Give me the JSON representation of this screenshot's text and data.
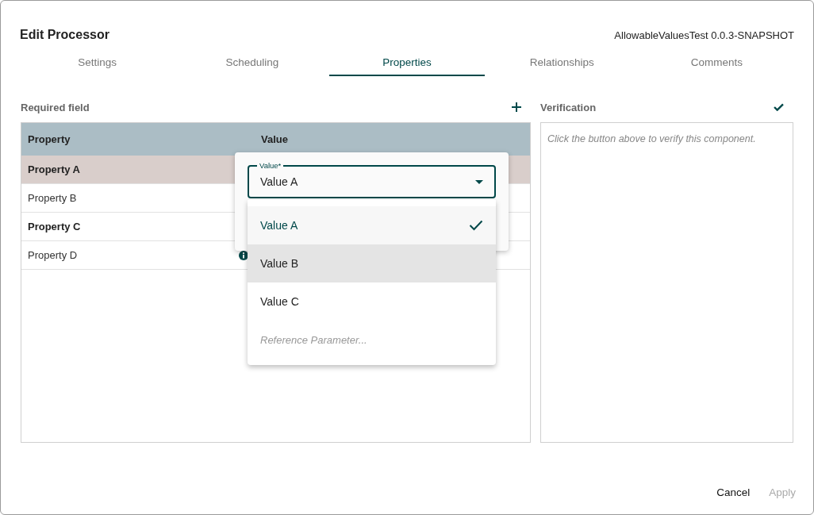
{
  "dialog": {
    "title": "Edit Processor",
    "component": "AllowableValuesTest 0.0.3-SNAPSHOT"
  },
  "tabs": [
    {
      "label": "Settings",
      "selected": false
    },
    {
      "label": "Scheduling",
      "selected": false
    },
    {
      "label": "Properties",
      "selected": true
    },
    {
      "label": "Relationships",
      "selected": false
    },
    {
      "label": "Comments",
      "selected": false
    }
  ],
  "properties": {
    "title": "Required field",
    "columns": [
      "Property",
      "Value"
    ],
    "rows": [
      {
        "name": "Property A",
        "required": true,
        "selected": true
      },
      {
        "name": "Property B",
        "required": false,
        "selected": false
      },
      {
        "name": "Property C",
        "required": true,
        "selected": false
      },
      {
        "name": "Property D",
        "required": false,
        "selected": false,
        "info": true
      }
    ]
  },
  "verification": {
    "title": "Verification",
    "message": "Click the button above to verify this component."
  },
  "editor": {
    "label": "Value*",
    "value": "Value A",
    "options": [
      {
        "label": "Value A",
        "kind": "value",
        "checked": true,
        "highlighted": false
      },
      {
        "label": "Value B",
        "kind": "value",
        "checked": false,
        "highlighted": true
      },
      {
        "label": "Value C",
        "kind": "value",
        "checked": false,
        "highlighted": false
      },
      {
        "label": "Reference Parameter...",
        "kind": "parameter",
        "checked": false,
        "highlighted": false
      }
    ]
  },
  "buttons": [
    {
      "label": "Cancel",
      "disabled": false
    },
    {
      "label": "Apply",
      "disabled": true
    }
  ]
}
